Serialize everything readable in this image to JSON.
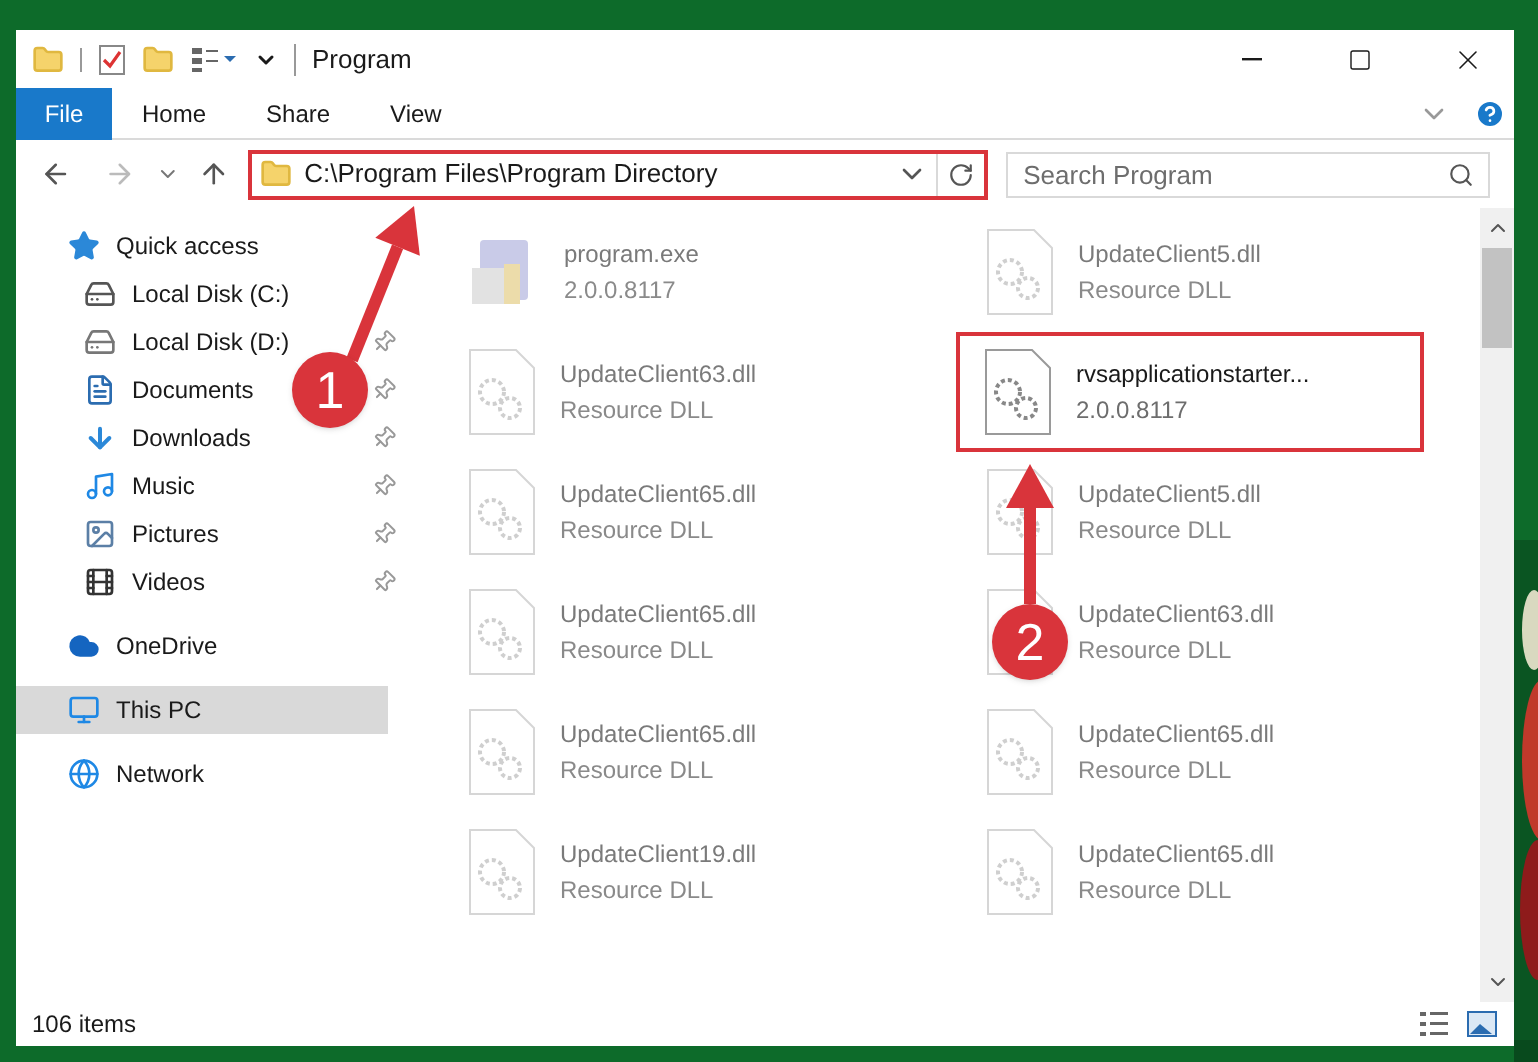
{
  "window": {
    "title": "Program"
  },
  "ribbon_tabs": [
    {
      "label": "File",
      "selected": true
    },
    {
      "label": "Home",
      "selected": false
    },
    {
      "label": "Share",
      "selected": false
    },
    {
      "label": "View",
      "selected": false
    }
  ],
  "address_bar": {
    "path": "C:\\Program Files\\Program Directory",
    "highlighted": true
  },
  "search": {
    "placeholder": "Search Program"
  },
  "sidebar": {
    "items": [
      {
        "label": "Quick access",
        "kind": "star",
        "selected": false,
        "children": [
          {
            "label": "Local Disk (C:)",
            "kind": "os-drive",
            "pinned": false,
            "selected": false
          },
          {
            "label": "Local Disk (D:)",
            "kind": "drive",
            "pinned": true,
            "selected": false
          },
          {
            "label": "Documents",
            "kind": "documents",
            "pinned": true,
            "selected": false
          },
          {
            "label": "Downloads",
            "kind": "downloads",
            "pinned": true,
            "selected": false
          },
          {
            "label": "Music",
            "kind": "music",
            "pinned": true,
            "selected": false
          },
          {
            "label": "Pictures",
            "kind": "pictures",
            "pinned": true,
            "selected": false
          },
          {
            "label": "Videos",
            "kind": "videos",
            "pinned": true,
            "selected": false
          }
        ]
      },
      {
        "label": "OneDrive",
        "kind": "cloud",
        "selected": false
      },
      {
        "label": "This PC",
        "kind": "pc",
        "selected": true
      },
      {
        "label": "Network",
        "kind": "network",
        "selected": false
      }
    ]
  },
  "files": [
    {
      "name": "program.exe",
      "detail": "2.0.0.8117",
      "kind": "exe",
      "blurred": true,
      "highlighted": false
    },
    {
      "name": "UpdateClient5.dll",
      "detail": "Resource DLL",
      "kind": "dll",
      "blurred": true,
      "highlighted": false
    },
    {
      "name": "UpdateClient63.dll",
      "detail": "Resource DLL",
      "kind": "dll",
      "blurred": true,
      "highlighted": false
    },
    {
      "name": "rvsapplicationstarter...",
      "detail": "2.0.0.8117",
      "kind": "dll",
      "blurred": false,
      "highlighted": true
    },
    {
      "name": "UpdateClient65.dll",
      "detail": "Resource DLL",
      "kind": "dll",
      "blurred": true,
      "highlighted": false
    },
    {
      "name": "UpdateClient5.dll",
      "detail": "Resource DLL",
      "kind": "dll",
      "blurred": true,
      "highlighted": false
    },
    {
      "name": "UpdateClient65.dll",
      "detail": "Resource DLL",
      "kind": "dll",
      "blurred": true,
      "highlighted": false
    },
    {
      "name": "UpdateClient63.dll",
      "detail": "Resource DLL",
      "kind": "dll",
      "blurred": true,
      "highlighted": false
    },
    {
      "name": "UpdateClient65.dll",
      "detail": "Resource DLL",
      "kind": "dll",
      "blurred": true,
      "highlighted": false
    },
    {
      "name": "UpdateClient65.dll",
      "detail": "Resource DLL",
      "kind": "dll",
      "blurred": true,
      "highlighted": false
    },
    {
      "name": "UpdateClient19.dll",
      "detail": "Resource DLL",
      "kind": "dll",
      "blurred": true,
      "highlighted": false
    },
    {
      "name": "UpdateClient65.dll",
      "detail": "Resource DLL",
      "kind": "dll",
      "blurred": true,
      "highlighted": false
    }
  ],
  "annotations": [
    {
      "number": "1"
    },
    {
      "number": "2"
    }
  ],
  "status_bar": {
    "item_count": "106 items"
  }
}
